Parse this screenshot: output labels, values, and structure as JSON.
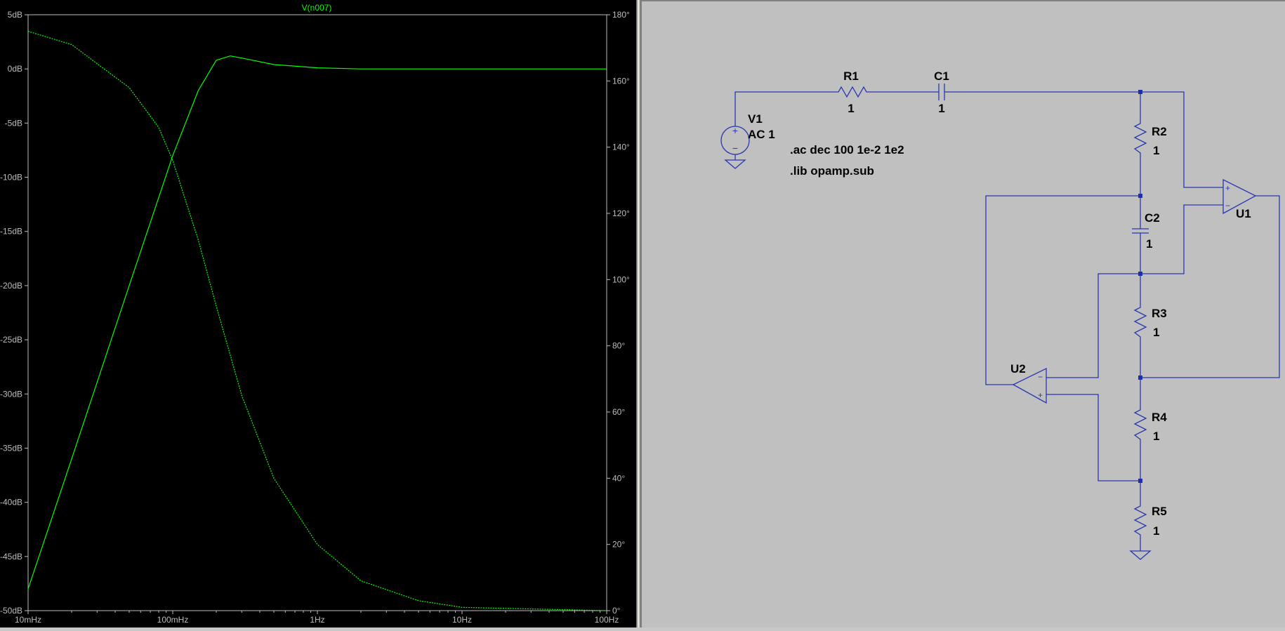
{
  "waveform": {
    "trace_name": "V(n007)",
    "colors": {
      "background": "#000000",
      "trace": "#00ff00",
      "axis": "#bcbcbc"
    },
    "left_axis_ticks": [
      "5dB",
      "0dB",
      "-5dB",
      "-10dB",
      "-15dB",
      "-20dB",
      "-25dB",
      "-30dB",
      "-35dB",
      "-40dB",
      "-45dB",
      "-50dB"
    ],
    "right_axis_ticks": [
      "180°",
      "160°",
      "140°",
      "120°",
      "100°",
      "80°",
      "60°",
      "40°",
      "20°",
      "0°"
    ],
    "x_axis_ticks": [
      "10mHz",
      "100mHz",
      "1Hz",
      "10Hz",
      "100Hz"
    ]
  },
  "chart_data": {
    "type": "line",
    "x_scale": "log",
    "xlim": [
      0.01,
      100
    ],
    "ylim_left_db": [
      -50,
      5
    ],
    "ylim_right_deg": [
      0,
      180
    ],
    "series": [
      {
        "name": "V(n007)",
        "axis": "left-dB",
        "style": "solid",
        "x": [
          0.01,
          0.02,
          0.05,
          0.1,
          0.15,
          0.2,
          0.25,
          0.3,
          0.5,
          1,
          2,
          5,
          10,
          100
        ],
        "y": [
          -48,
          -36,
          -20,
          -8,
          -2,
          0.8,
          1.2,
          1.0,
          0.4,
          0.1,
          0.0,
          0.0,
          0.0,
          0.0
        ]
      },
      {
        "name": "",
        "axis": "right-deg",
        "style": "dotted",
        "x": [
          0.01,
          0.02,
          0.05,
          0.08,
          0.1,
          0.15,
          0.2,
          0.3,
          0.5,
          1,
          2,
          5,
          10,
          100
        ],
        "y": [
          175,
          171,
          158,
          146,
          136,
          112,
          92,
          65,
          40,
          20,
          9,
          3,
          1,
          0
        ]
      }
    ]
  },
  "schematic": {
    "colors": {
      "background": "#c0c0c0",
      "wire": "#2a36b1",
      "text": "#000000"
    },
    "components": {
      "R1": {
        "name": "R1",
        "value": "1"
      },
      "C1": {
        "name": "C1",
        "value": "1"
      },
      "R2": {
        "name": "R2",
        "value": "1"
      },
      "C2": {
        "name": "C2",
        "value": "1"
      },
      "R3": {
        "name": "R3",
        "value": "1"
      },
      "R4": {
        "name": "R4",
        "value": "1"
      },
      "R5": {
        "name": "R5",
        "value": "1"
      },
      "V1": {
        "name": "V1",
        "value": "AC 1"
      },
      "U1": {
        "name": "U1"
      },
      "U2": {
        "name": "U2"
      }
    },
    "directives": [
      ".ac dec 100 1e-2 1e2",
      ".lib opamp.sub"
    ],
    "opamp_pins": {
      "plus": "+",
      "minus": "−"
    }
  }
}
